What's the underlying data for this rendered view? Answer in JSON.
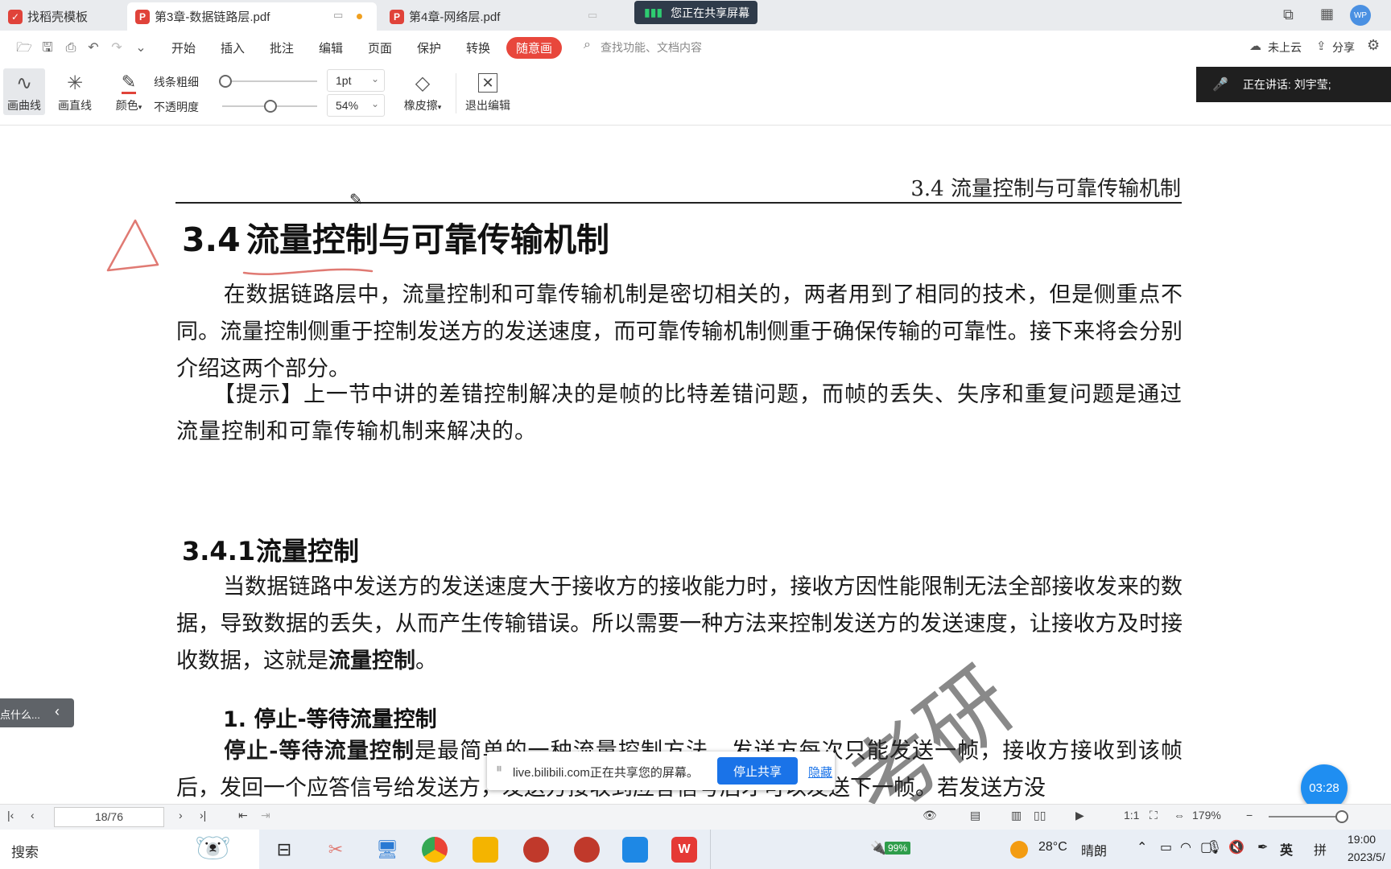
{
  "tabs": [
    {
      "label": "找稻壳模板"
    },
    {
      "label": "第3章-数据链路层.pdf"
    },
    {
      "label": "第4章-网络层.pdf"
    }
  ],
  "share_banner": "您正在共享屏幕",
  "avatar_text": "WP",
  "menu": {
    "items": [
      "开始",
      "插入",
      "批注",
      "编辑",
      "页面",
      "保护",
      "转换",
      "随意画"
    ],
    "search_placeholder": "查找功能、文档内容",
    "cloud": "未上云",
    "share": "分享"
  },
  "toolbar": {
    "curve": "画曲线",
    "line": "画直线",
    "color": "颜色",
    "line_width_label": "线条粗细",
    "opacity_label": "不透明度",
    "line_width_value": "1pt",
    "opacity_value": "54%",
    "eraser": "橡皮擦",
    "exit": "退出编辑"
  },
  "speaker": "正在讲话: 刘宇莹;",
  "doc": {
    "running_header": "3.4  流量控制与可靠传输机制",
    "section_number": "3.4",
    "section_title": "流量控制与可靠传输机制",
    "p1": "在数据链路层中，流量控制和可靠传输机制是密切相关的，两者用到了相同的技术，但是侧重点不同。流量控制侧重于控制发送方的发送速度，而可靠传输机制侧重于确保传输的可靠性。接下来将会分别介绍这两个部分。",
    "p2": "【提示】上一节中讲的差错控制解决的是帧的比特差错问题，而帧的丢失、失序和重复问题是通过流量控制和可靠传输机制来解决的。",
    "subsection_number": "3.4.1",
    "subsection_title": "流量控制",
    "p3_pre": "当数据链路中发送方的发送速度大于接收方的接收能力时，接收方因性能限制无法全部接收发来的数据，导致数据的丢失，从而产生传输错误。所以需要一种方法来控制发送方的发送速度，让接收方及时接收数据，这就是",
    "p3_bold": "流量控制",
    "p3_post": "。",
    "item1": "1.  停止-等待流量控制",
    "p4_bold": "停止-等待流量控制",
    "p4_rest": "是最简单的一种流量控制方法，发送方每次只能发送一帧，接收方接收到该帧后，发回一个应答信号给发送方，发送方接收到应答信号后才可以发送下一帧。若发送方没",
    "watermark": "考研"
  },
  "side_hint": "点什么...",
  "share_notice": {
    "text": "live.bilibili.com正在共享您的屏幕。",
    "stop": "停止共享",
    "hide": "隐藏"
  },
  "timer": "03:28",
  "status": {
    "page": "18/76",
    "zoom": "179%"
  },
  "taskbar": {
    "search": "搜索",
    "battery": "99%",
    "temperature": "28°C",
    "weather": "晴朗",
    "ime1": "英",
    "ime2": "拼",
    "time": "19:00",
    "date": "2023/5/"
  },
  "colors": {
    "accent": "#e8473c",
    "blue": "#1a73e8",
    "ink": "#e07a73"
  }
}
